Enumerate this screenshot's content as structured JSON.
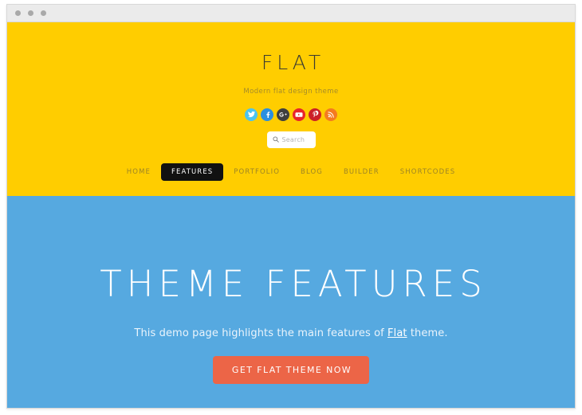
{
  "window": {
    "dots": [
      "close-dot",
      "minimize-dot",
      "maximize-dot"
    ]
  },
  "header": {
    "title": "FLAT",
    "tagline": "Modern flat design theme",
    "background_color": "#ffcd00",
    "social": [
      {
        "name": "twitter",
        "label": "Twitter",
        "color": "#4bc4f0",
        "glyph": "twitter-icon"
      },
      {
        "name": "facebook",
        "label": "Facebook",
        "color": "#2a8fe0",
        "glyph": "facebook-icon"
      },
      {
        "name": "googleplus",
        "label": "Google Plus",
        "color": "#3f3f3f",
        "glyph": "google-plus-icon"
      },
      {
        "name": "youtube",
        "label": "YouTube",
        "color": "#e8252b",
        "glyph": "youtube-icon"
      },
      {
        "name": "pinterest",
        "label": "Pinterest",
        "color": "#cb1f28",
        "glyph": "pinterest-icon"
      },
      {
        "name": "rss",
        "label": "RSS",
        "color": "#f47b20",
        "glyph": "rss-icon"
      }
    ],
    "search": {
      "placeholder": "Search",
      "value": "",
      "icon": "search-icon"
    },
    "nav": [
      {
        "label": "HOME",
        "active": false
      },
      {
        "label": "FEATURES",
        "active": true
      },
      {
        "label": "PORTFOLIO",
        "active": false
      },
      {
        "label": "BLOG",
        "active": false
      },
      {
        "label": "BUILDER",
        "active": false
      },
      {
        "label": "SHORTCODES",
        "active": false
      }
    ]
  },
  "hero": {
    "background_color": "#56a9e0",
    "title": "THEME FEATURES",
    "subtitle_before": "This demo page highlights the main features of ",
    "subtitle_link": "Flat",
    "subtitle_after": " theme.",
    "cta_label": "GET FLAT THEME NOW",
    "cta_color": "#ec6547"
  }
}
